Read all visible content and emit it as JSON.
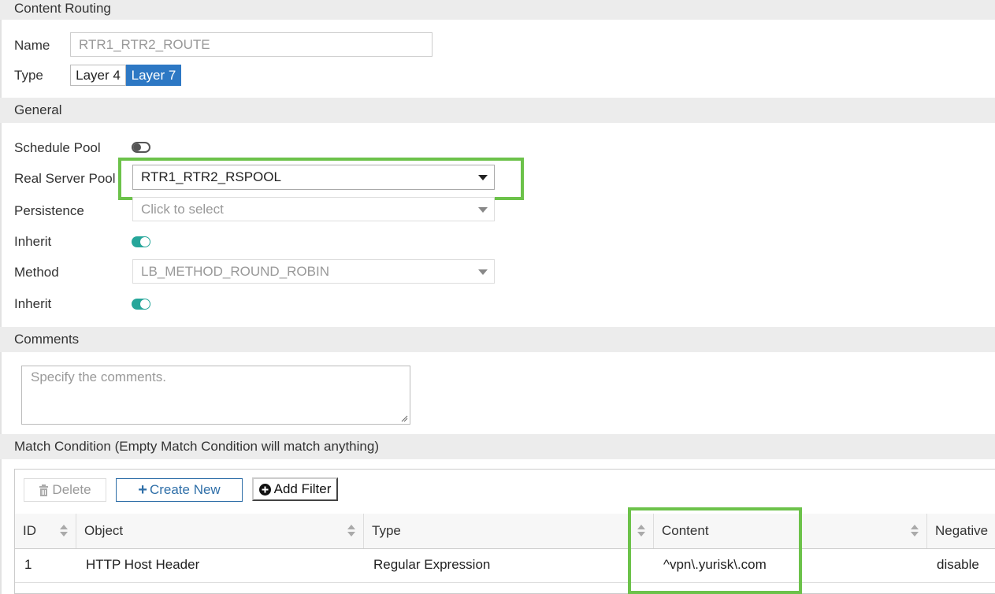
{
  "sections": {
    "content_routing": "Content Routing",
    "general": "General",
    "comments": "Comments",
    "match_condition": "Match Condition (Empty Match Condition will match anything)"
  },
  "form": {
    "name_label": "Name",
    "name_value": "RTR1_RTR2_ROUTE",
    "type_label": "Type",
    "type_options": [
      "Layer 4",
      "Layer 7"
    ],
    "type_selected": "Layer 7",
    "schedule_pool_label": "Schedule Pool",
    "schedule_pool_on": false,
    "real_server_pool_label": "Real Server Pool",
    "real_server_pool_value": "RTR1_RTR2_RSPOOL",
    "persistence_label": "Persistence",
    "persistence_placeholder": "Click to select",
    "inherit1_label": "Inherit",
    "inherit1_on": true,
    "method_label": "Method",
    "method_value": "LB_METHOD_ROUND_ROBIN",
    "inherit2_label": "Inherit",
    "inherit2_on": true,
    "comments_placeholder": "Specify the comments."
  },
  "toolbar": {
    "delete_label": "Delete",
    "create_new_label": "Create New",
    "add_filter_label": "Add Filter"
  },
  "table": {
    "headers": [
      "ID",
      "Object",
      "Type",
      "Content",
      "Negative"
    ],
    "rows": [
      {
        "id": "1",
        "object": "HTTP Host Header",
        "type": "Regular Expression",
        "content": "^vpn\\.yurisk\\.com",
        "negative": "disable"
      }
    ]
  },
  "colors": {
    "highlight_green": "#6cc24a",
    "toggle_on": "#26a69a",
    "selected_blue": "#2d78c4",
    "create_button_blue": "#2f6fa8"
  }
}
